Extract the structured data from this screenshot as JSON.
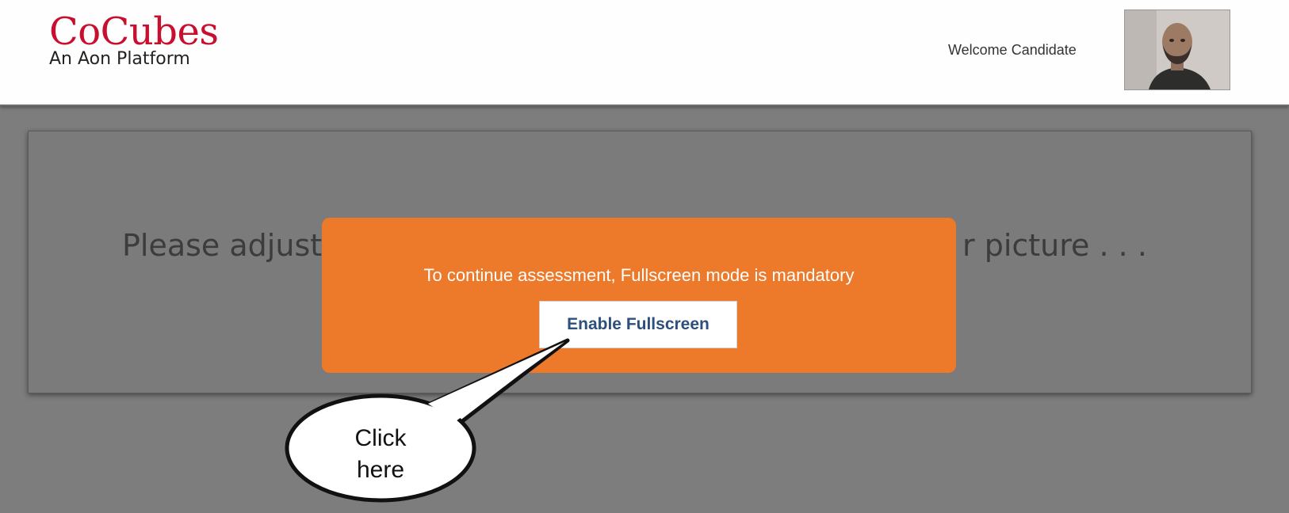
{
  "header": {
    "logo_title": "CoCubes",
    "logo_subtitle": "An Aon Platform",
    "welcome_text": "Welcome Candidate",
    "avatar_icon": "user-photo-icon"
  },
  "panel": {
    "message_left": "Please adjust",
    "message_right": "r picture . . ."
  },
  "modal": {
    "message": "To continue assessment, Fullscreen mode is mandatory",
    "button_label": "Enable Fullscreen",
    "background_color": "#ec7a2a"
  },
  "callout": {
    "line1": "Click",
    "line2": "here"
  },
  "colors": {
    "brand_red": "#c8102e",
    "overlay_gray": "#7d7d7d",
    "button_text": "#2c4f7c"
  }
}
